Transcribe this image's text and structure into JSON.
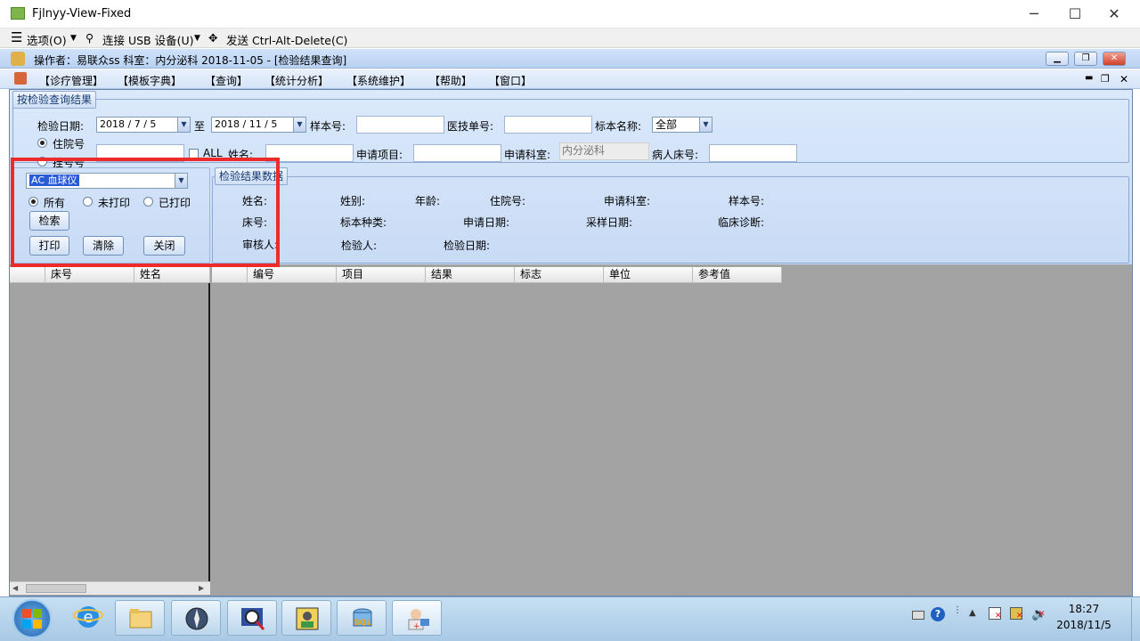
{
  "window": {
    "title": "Fjlnyy-View-Fixed"
  },
  "toolbar": {
    "options": "选项(O)",
    "usb": "连接 USB 设备(U)",
    "send_cad": "发送 Ctrl-Alt-Delete(C)"
  },
  "app": {
    "title": "操作者：易联众ss  科室：内分泌科  2018-11-05 - [检验结果查询]"
  },
  "menu": [
    "【诊疗管理】",
    "【模板字典】",
    "【查询】",
    "【统计分析】",
    "【系统维护】",
    "【帮助】",
    "【窗口】"
  ],
  "query": {
    "group_title": "按检验查询结果",
    "date_label": "检验日期:",
    "date_from": "2018 / 7 / 5",
    "to_label": "至",
    "date_to": "2018 / 11 / 5",
    "sample_no_label": "样本号:",
    "tech_no_label": "医技单号:",
    "specimen_label": "标本名称:",
    "specimen_value": "全部",
    "radio_inpatient": "住院号",
    "radio_outpatient": "挂号号",
    "all_label": "ALL",
    "name_label": "姓名:",
    "apply_item_label": "申请项目:",
    "apply_dept_label": "申请科室:",
    "apply_dept_value": "内分泌科",
    "bed_label": "病人床号:"
  },
  "left": {
    "instrument_value": "AC 血球仪",
    "filter_all": "所有",
    "filter_unprinted": "未打印",
    "filter_printed": "已打印",
    "search_btn": "检索",
    "print_btn": "打印",
    "clear_btn": "清除",
    "close_btn": "关闭",
    "columns": [
      "床号",
      "姓名"
    ]
  },
  "result": {
    "group_title": "检验结果数据",
    "fields_row1": [
      "姓名:",
      "姓别:",
      "年龄:",
      "住院号:",
      "申请科室:",
      "样本号:"
    ],
    "fields_row2": [
      "床号:",
      "标本种类:",
      "申请日期:",
      "采样日期:",
      "临床诊断:"
    ],
    "fields_row3": [
      "审核人:",
      "检验人:",
      "检验日期:"
    ],
    "columns": [
      "编号",
      "项目",
      "结果",
      "标志",
      "单位",
      "参考值"
    ]
  },
  "tray": {
    "time": "18:27",
    "date": "2018/11/5"
  },
  "colors": {
    "highlight_box": "#ee2b2b",
    "panel": "#cfe0f6",
    "grid_bg": "#a3a3a3"
  }
}
